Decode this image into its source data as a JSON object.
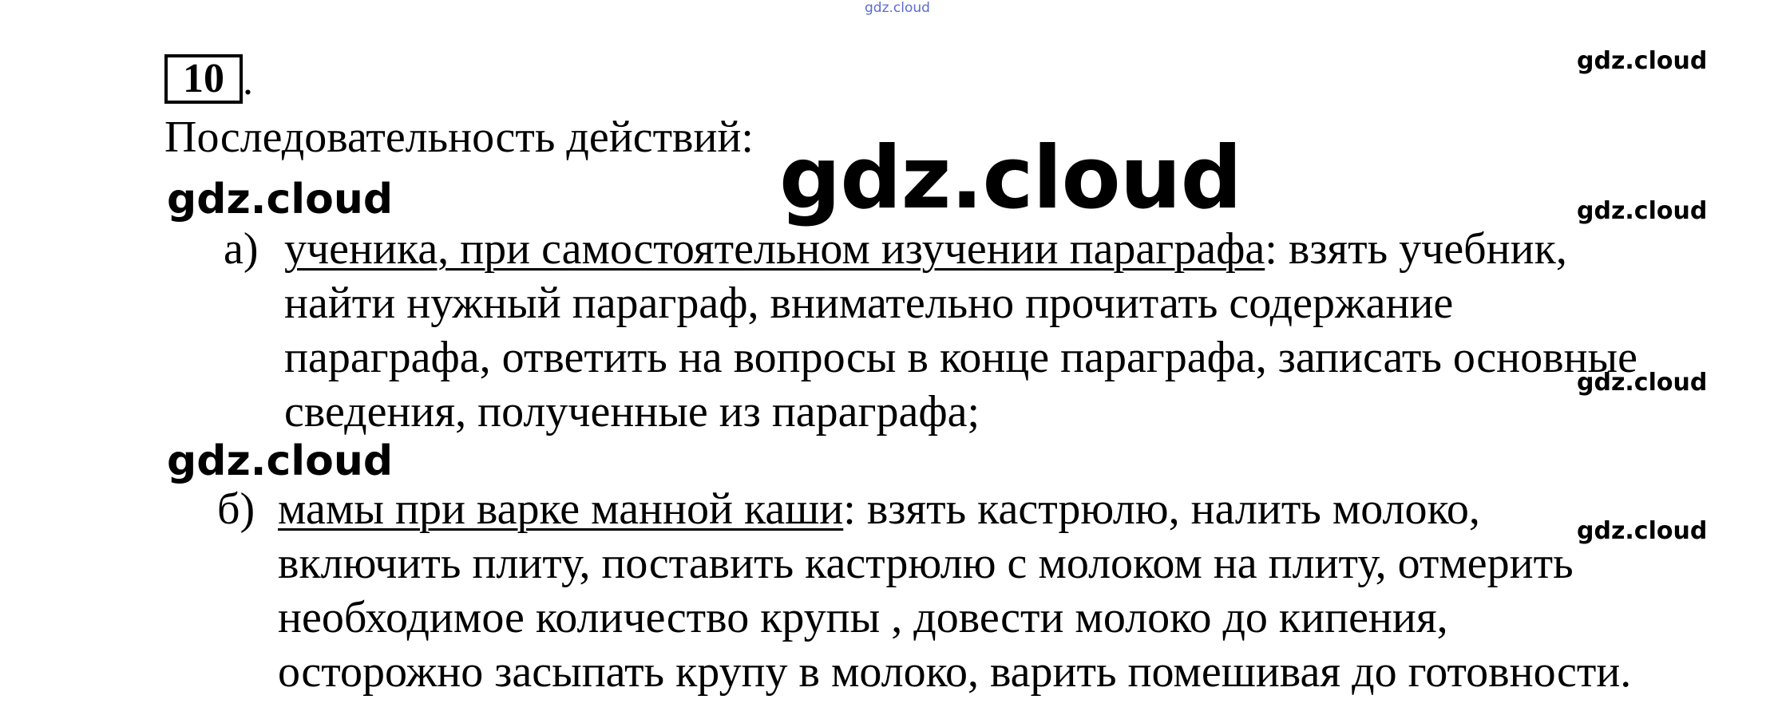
{
  "watermarks": {
    "top_small": "gdz.cloud",
    "big": "gdz.cloud",
    "left_1": "gdz.cloud",
    "left_2": "gdz.cloud",
    "right_1": "gdz.cloud",
    "right_2": "gdz.cloud",
    "right_3": "gdz.cloud",
    "right_4": "gdz.cloud"
  },
  "problem": {
    "number": "10",
    "dot": "."
  },
  "heading": "Последовательность действий:",
  "items": [
    {
      "marker": "а)",
      "underlined": "ученика, при самостоятельном изучении параграфа",
      "after_underline": ":  взять учебник,",
      "lines": [
        "найти нужный параграф, внимательно прочитать содержание",
        "параграфа, ответить на вопросы в конце параграфа, записать основные",
        "сведения, полученные из параграфа;"
      ]
    },
    {
      "marker": "б)",
      "underlined": "мамы при варке манной каши",
      "after_underline": ": взять кастрюлю, налить молоко,",
      "lines": [
        "включить плиту, поставить кастрюлю с молоком на плиту, отмерить",
        "необходимое количество крупы , довести молоко до кипения,",
        "осторожно засыпать крупу в молоко, варить помешивая до готовности."
      ]
    }
  ]
}
